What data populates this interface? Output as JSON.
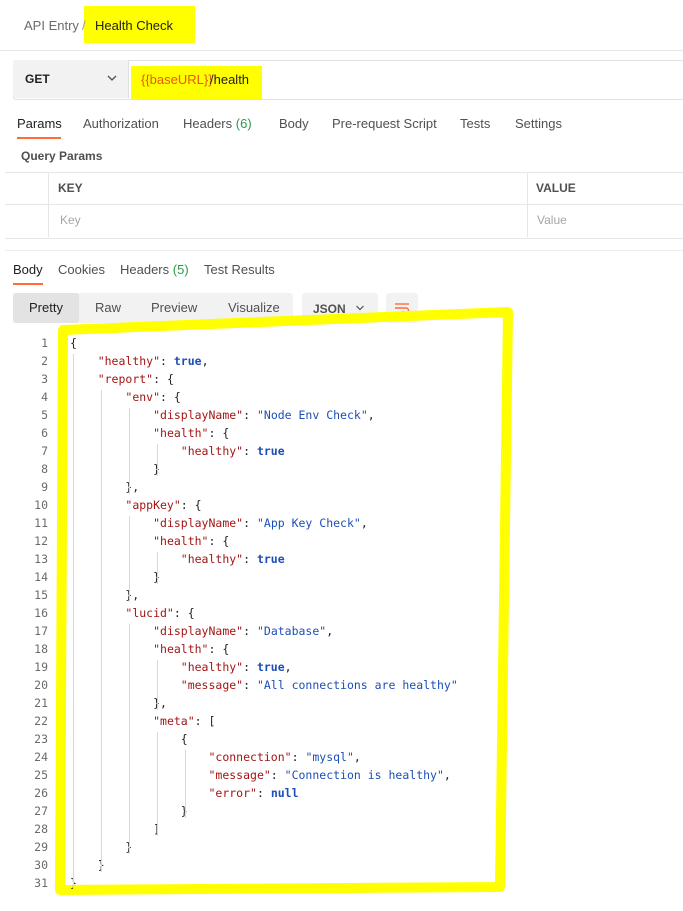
{
  "breadcrumb": {
    "parent": "API Entry",
    "separator": "/",
    "current": "Health Check"
  },
  "request": {
    "method": "GET",
    "url_variable": "{{baseURL}}",
    "url_path": "/health",
    "tabs": [
      {
        "label": "Params",
        "active": true
      },
      {
        "label": "Authorization"
      },
      {
        "label": "Headers",
        "count": "(6)"
      },
      {
        "label": "Body"
      },
      {
        "label": "Pre-request Script"
      },
      {
        "label": "Tests"
      },
      {
        "label": "Settings"
      }
    ],
    "query_params_title": "Query Params",
    "table": {
      "key_header": "KEY",
      "value_header": "VALUE",
      "key_placeholder": "Key",
      "value_placeholder": "Value"
    }
  },
  "response": {
    "tabs": [
      {
        "label": "Body",
        "active": true
      },
      {
        "label": "Cookies"
      },
      {
        "label": "Headers",
        "count": "(5)"
      },
      {
        "label": "Test Results"
      }
    ],
    "view_modes": [
      "Pretty",
      "Raw",
      "Preview",
      "Visualize"
    ],
    "active_view": "Pretty",
    "format": "JSON",
    "wrap_icon": "wrap-lines-icon",
    "code_lines": [
      "{",
      "    \"healthy\": true,",
      "    \"report\": {",
      "        \"env\": {",
      "            \"displayName\": \"Node Env Check\",",
      "            \"health\": {",
      "                \"healthy\": true",
      "            }",
      "        },",
      "        \"appKey\": {",
      "            \"displayName\": \"App Key Check\",",
      "            \"health\": {",
      "                \"healthy\": true",
      "            }",
      "        },",
      "        \"lucid\": {",
      "            \"displayName\": \"Database\",",
      "            \"health\": {",
      "                \"healthy\": true,",
      "                \"message\": \"All connections are healthy\"",
      "            },",
      "            \"meta\": [",
      "                {",
      "                    \"connection\": \"mysql\",",
      "                    \"message\": \"Connection is healthy\",",
      "                    \"error\": null",
      "                }",
      "            ]",
      "        }",
      "    }",
      "}"
    ]
  },
  "colors": {
    "highlight": "#ffff00",
    "accent": "#ff6c37",
    "variable": "#e8590c",
    "json_key": "#a31515",
    "json_value": "#1d4eb5",
    "count": "#2c9a4b"
  }
}
